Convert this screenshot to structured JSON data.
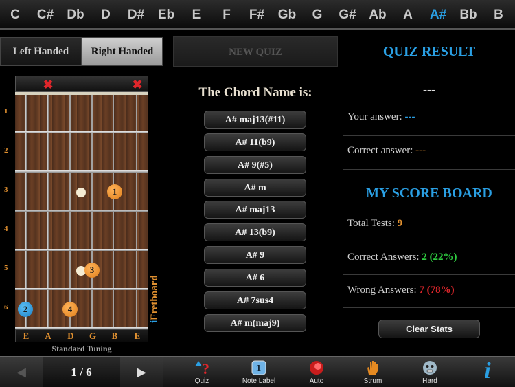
{
  "keys": [
    "C",
    "C#",
    "Db",
    "D",
    "D#",
    "Eb",
    "E",
    "F",
    "F#",
    "Gb",
    "G",
    "G#",
    "Ab",
    "A",
    "A#",
    "Bb",
    "B"
  ],
  "active_key": "A#",
  "hand": {
    "left": "Left Handed",
    "right": "Right Handed",
    "selected": "Right Handed"
  },
  "fretboard": {
    "fret_numbers": [
      "1",
      "2",
      "3",
      "4",
      "5",
      "6"
    ],
    "string_names": [
      "E",
      "A",
      "D",
      "G",
      "B",
      "E"
    ],
    "muted_strings": [
      "E (6th)",
      "E (1st)"
    ],
    "tuning": "Standard Tuning",
    "brand": "Fretboard",
    "brand_prefix": "i",
    "finger_dots": [
      {
        "finger": "1",
        "string": 5,
        "fret": 3,
        "color": "orange"
      },
      {
        "finger": "3",
        "string": 4,
        "fret": 5,
        "color": "orange"
      },
      {
        "finger": "4",
        "string": 3,
        "fret": 6,
        "color": "orange"
      },
      {
        "finger": "2",
        "string": 1,
        "fret": 6,
        "color": "blue"
      }
    ]
  },
  "quiz": {
    "new_quiz": "NEW QUIZ",
    "heading": "The Chord Name is:",
    "choices": [
      "A# maj13(#11)",
      "A# 11(b9)",
      "A# 9(#5)",
      "A# m",
      "A# maj13",
      "A# 13(b9)",
      "A# 9",
      "A# 6",
      "A# 7sus4",
      "A# m(maj9)"
    ]
  },
  "result": {
    "title": "QUIZ RESULT",
    "chord": "---",
    "your_answer_label": "Your answer: ",
    "your_answer": "---",
    "correct_answer_label": "Correct answer: ",
    "correct_answer": "---",
    "score_title": "MY SCORE BOARD",
    "total_label": "Total Tests: ",
    "total": "9",
    "correct_label": "Correct Answers: ",
    "correct": "2 (22%)",
    "wrong_label": "Wrong Answers: ",
    "wrong": "7 (78%)",
    "clear": "Clear Stats"
  },
  "bottom": {
    "page": "1 / 6",
    "tools": [
      {
        "label": "Quiz",
        "icon": "question-icon"
      },
      {
        "label": "Note Label",
        "icon": "note-label-icon"
      },
      {
        "label": "Auto",
        "icon": "auto-icon"
      },
      {
        "label": "Strum",
        "icon": "hand-icon"
      },
      {
        "label": "Hard",
        "icon": "face-icon"
      }
    ],
    "info": "i"
  },
  "colors": {
    "accent": "#2a9fe3",
    "orange": "#e09030",
    "green": "#2ecc40",
    "red": "#e0262b"
  }
}
